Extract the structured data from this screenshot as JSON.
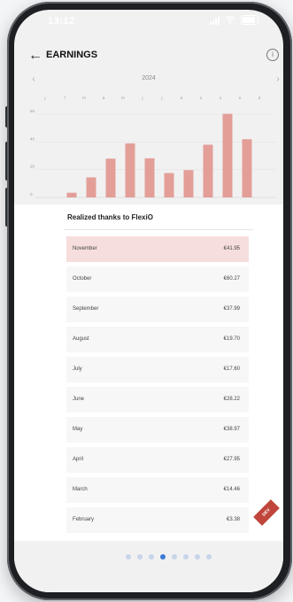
{
  "status_bar": {
    "time": "13:12"
  },
  "header": {
    "title": "EARNINGS",
    "back_icon": "arrow-left-icon",
    "info_icon": "info-circle-icon"
  },
  "chart_data": {
    "type": "bar",
    "title": "",
    "year_label": "2024",
    "categories": [
      "j",
      "f",
      "m",
      "a",
      "m",
      "j",
      "j",
      "a",
      "s",
      "o",
      "n",
      "d"
    ],
    "values": [
      0,
      3.38,
      14.46,
      27.95,
      38.97,
      28.22,
      17.6,
      19.7,
      37.99,
      60.27,
      41.95,
      0
    ],
    "ylim": [
      0,
      60
    ],
    "yticks": [
      "0",
      "20",
      "40",
      "60"
    ],
    "bar_color": "#e39e98",
    "grid": true
  },
  "section": {
    "title": "Realized thanks to FlexiO"
  },
  "earnings": [
    {
      "month": "November",
      "amount": "€41.95",
      "selected": true
    },
    {
      "month": "October",
      "amount": "€60.27",
      "selected": false
    },
    {
      "month": "September",
      "amount": "€37.99",
      "selected": false
    },
    {
      "month": "August",
      "amount": "€19.70",
      "selected": false
    },
    {
      "month": "July",
      "amount": "€17.60",
      "selected": false
    },
    {
      "month": "June",
      "amount": "€28.22",
      "selected": false
    },
    {
      "month": "May",
      "amount": "€38.97",
      "selected": false
    },
    {
      "month": "April",
      "amount": "€27.95",
      "selected": false
    },
    {
      "month": "March",
      "amount": "€14.46",
      "selected": false
    },
    {
      "month": "February",
      "amount": "€3.38",
      "selected": false
    }
  ],
  "ribbon": {
    "label": "DEV"
  },
  "pager": {
    "count": 8,
    "active_index": 3
  },
  "colors": {
    "accent": "#3a7bd5",
    "selected_row": "#f6dedc",
    "bar": "#e39e98"
  }
}
